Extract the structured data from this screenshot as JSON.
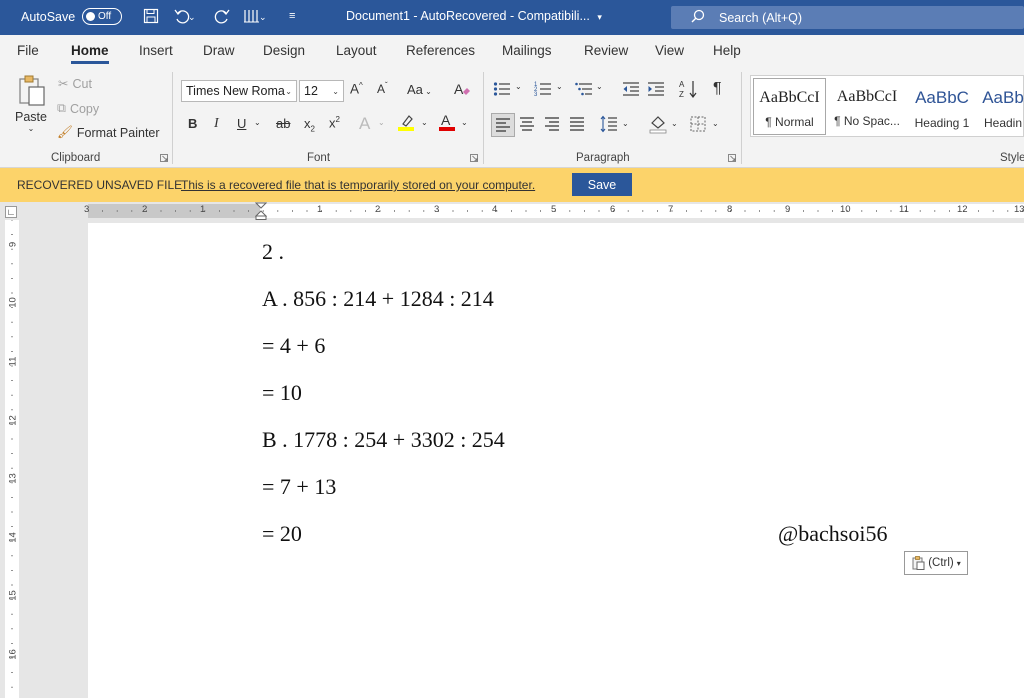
{
  "titlebar": {
    "autosave_label": "AutoSave",
    "autosave_state": "Off",
    "document_title": "Document1  -  AutoRecovered  -  Compatibili...",
    "search_placeholder": "Search (Alt+Q)"
  },
  "tabs": [
    "File",
    "Home",
    "Insert",
    "Draw",
    "Design",
    "Layout",
    "References",
    "Mailings",
    "Review",
    "View",
    "Help"
  ],
  "active_tab": "Home",
  "clipboard": {
    "paste": "Paste",
    "cut": "Cut",
    "copy": "Copy",
    "format_painter": "Format Painter",
    "label": "Clipboard"
  },
  "font": {
    "family": "Times New Roma",
    "size": "12",
    "label": "Font",
    "case_label": "Aa",
    "bold": "B",
    "italic": "I",
    "underline": "U",
    "strike": "ab",
    "highlight_color": "#ffff00",
    "font_color": "#e00000"
  },
  "paragraph": {
    "label": "Paragraph"
  },
  "styles": {
    "label": "Style",
    "items": [
      {
        "preview": "AaBbCcI",
        "name": "¶ Normal"
      },
      {
        "preview": "AaBbCcI",
        "name": "¶ No Spac..."
      },
      {
        "preview": "AaBbC",
        "name": "Heading 1"
      },
      {
        "preview": "AaBb",
        "name": "Headin"
      }
    ]
  },
  "infobar": {
    "title": "RECOVERED UNSAVED FILE",
    "message": "This is a recovered file that is temporarily stored on your computer.",
    "save_label": "Save",
    "background": "#fcd36a"
  },
  "ruler": {
    "top_numbers": [
      "3",
      "2",
      "1",
      "1",
      "2",
      "3",
      "4",
      "5",
      "6",
      "7",
      "8",
      "9",
      "10",
      "11",
      "12",
      "13"
    ],
    "left_numbers": [
      "9",
      "10",
      "11",
      "12",
      "13",
      "14",
      "15",
      "16"
    ]
  },
  "document": {
    "lines": [
      "2 .",
      "A . 856 : 214 + 1284 : 214",
      "= 4 + 6",
      "= 10",
      "B . 1778 : 254 + 3302 : 254",
      "= 7 + 13",
      "= 20"
    ],
    "signature": "@bachsoi56",
    "paste_options": "(Ctrl)"
  },
  "colors": {
    "titlebar": "#2b579a",
    "ribbon": "#f3f3f3",
    "accent": "#2b579a"
  }
}
